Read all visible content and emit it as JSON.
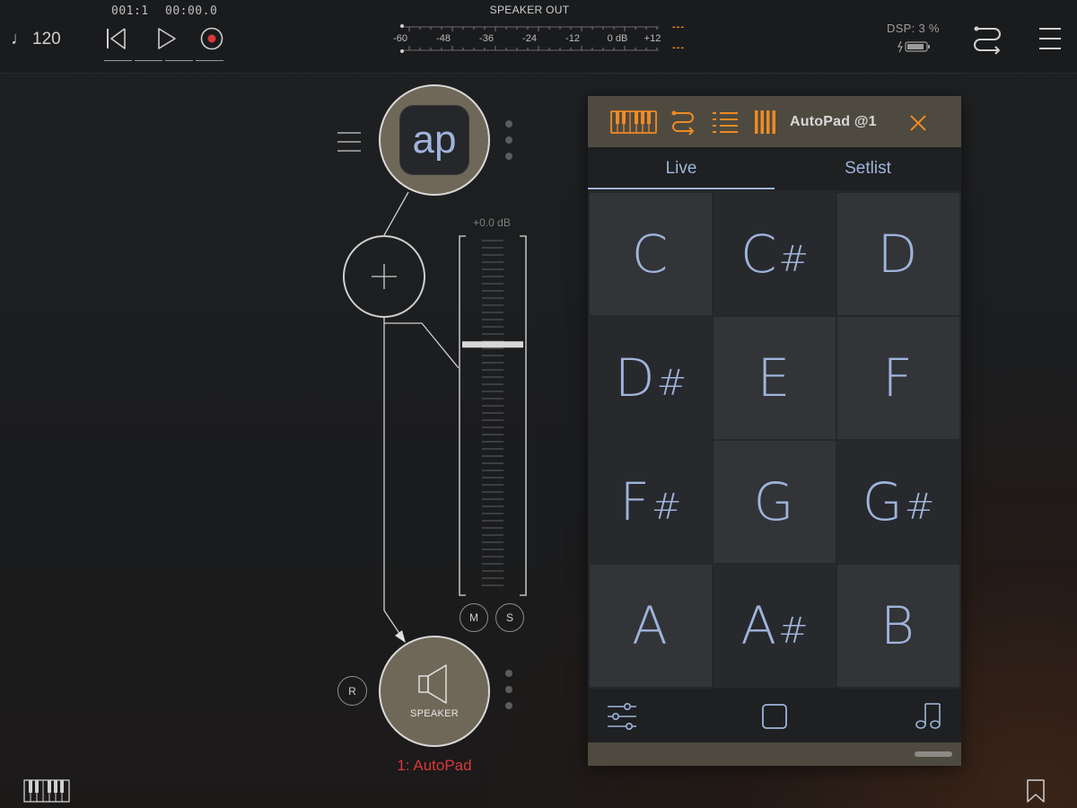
{
  "transport": {
    "tempo_symbol": "♩",
    "tempo": "120",
    "position": "001:1",
    "time": "00:00.0"
  },
  "meter": {
    "title": "SPEAKER OUT",
    "scale": [
      "-60",
      "-48",
      "-36",
      "-24",
      "-12",
      "0 dB",
      "+12"
    ],
    "peak_left": "---",
    "peak_right": "---"
  },
  "status": {
    "dsp": "DSP:  3 %"
  },
  "patch": {
    "instrument_icon_text": "ap",
    "gain": "+0.0 dB",
    "fader_level": 0.7,
    "mute_label": "M",
    "solo_label": "S",
    "record_label": "R",
    "output_label": "SPEAKER",
    "node_name": "1: AutoPad"
  },
  "panel": {
    "title": "AutoPad @1",
    "tabs": [
      "Live",
      "Setlist"
    ],
    "active_tab": "Live",
    "pads": [
      {
        "note": "C",
        "sharp": ""
      },
      {
        "note": "C",
        "sharp": "#"
      },
      {
        "note": "D",
        "sharp": ""
      },
      {
        "note": "D",
        "sharp": "#"
      },
      {
        "note": "E",
        "sharp": ""
      },
      {
        "note": "F",
        "sharp": ""
      },
      {
        "note": "F",
        "sharp": "#"
      },
      {
        "note": "G",
        "sharp": ""
      },
      {
        "note": "G",
        "sharp": "#"
      },
      {
        "note": "A",
        "sharp": ""
      },
      {
        "note": "A",
        "sharp": "#"
      },
      {
        "note": "B",
        "sharp": ""
      }
    ]
  },
  "colors": {
    "accent_orange": "#f08a24",
    "pad_text_blue": "#9fb4dc",
    "record_red": "#d8393a",
    "node_fill": "#6f6858",
    "panel_header": "#4e4a40"
  },
  "icons": {
    "rewind": "skip-back-icon",
    "play": "play-icon",
    "record": "record-icon",
    "battery": "battery-charging-icon",
    "routing": "routing-icon",
    "menu": "hamburger-menu-icon",
    "keyboard": "piano-keyboard-icon",
    "bookmark": "bookmark-icon",
    "mixer": "sliders-icon",
    "stop": "stop-icon",
    "notes": "music-notes-icon",
    "close": "close-icon"
  }
}
